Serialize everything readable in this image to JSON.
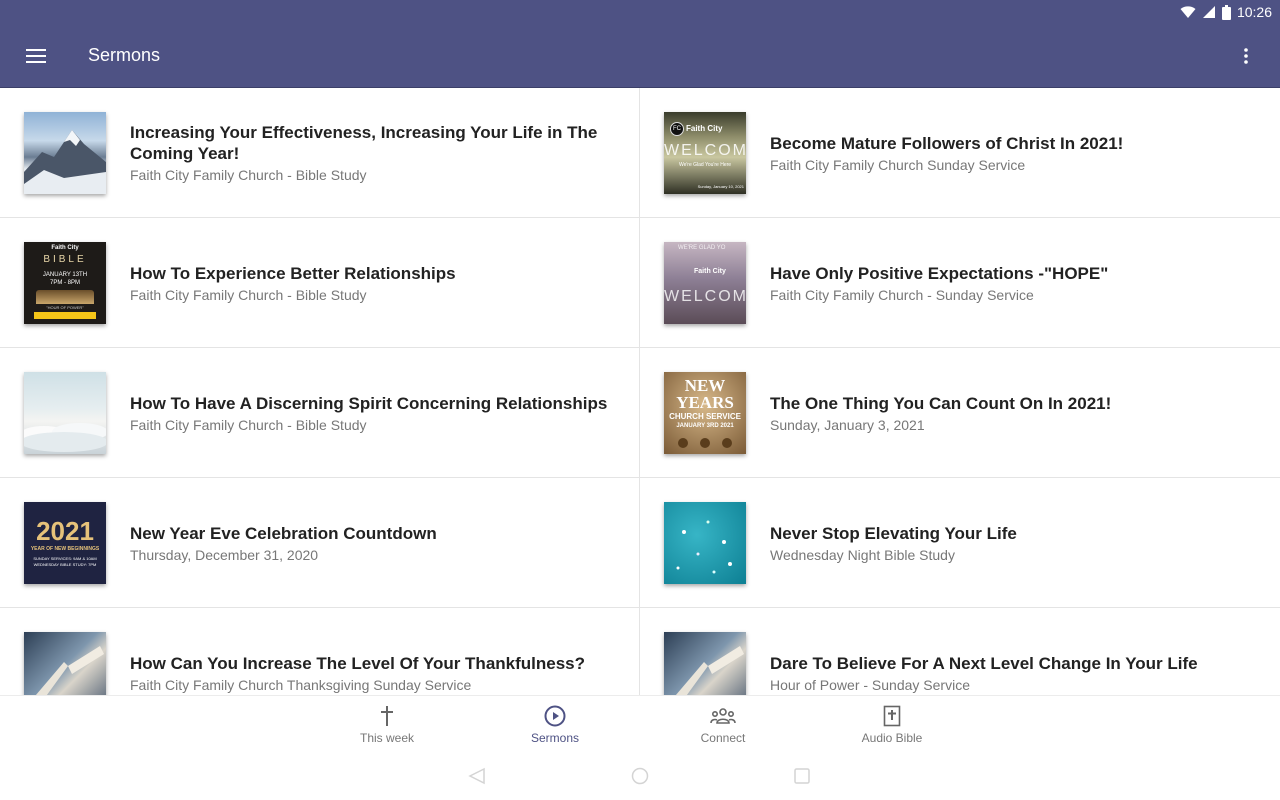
{
  "status": {
    "time": "10:26"
  },
  "appbar": {
    "title": "Sermons"
  },
  "sermons": [
    {
      "title": "Increasing Your Effectiveness, Increasing Your Life in The Coming Year!",
      "subtitle": "Faith City Family Church - Bible Study",
      "thumb": "mountain"
    },
    {
      "title": "Become Mature Followers of Christ In 2021!",
      "subtitle": "Faith City Family Church Sunday Service",
      "thumb": "welcome"
    },
    {
      "title": "How To Experience Better Relationships",
      "subtitle": "Faith City Family Church - Bible Study",
      "thumb": "bible"
    },
    {
      "title": "Have Only Positive Expectations -\"HOPE\"",
      "subtitle": "Faith City Family Church - Sunday Service",
      "thumb": "welcome2"
    },
    {
      "title": "How To Have A Discerning Spirit Concerning Relationships",
      "subtitle": "Faith City Family Church - Bible Study",
      "thumb": "clouds"
    },
    {
      "title": "The One Thing You Can Count On In 2021!",
      "subtitle": "Sunday, January 3, 2021",
      "thumb": "newyears"
    },
    {
      "title": "New Year Eve Celebration Countdown",
      "subtitle": "Thursday, December 31, 2020",
      "thumb": "2021"
    },
    {
      "title": "Never Stop Elevating Your Life",
      "subtitle": "Wednesday Night Bible Study",
      "thumb": "teal"
    },
    {
      "title": "How Can You Increase The Level Of Your Thankfulness?",
      "subtitle": "Faith City Family Church Thanksgiving Sunday Service",
      "thumb": "book"
    },
    {
      "title": "Dare To Believe For A Next Level Change In Your Life",
      "subtitle": "Hour of Power - Sunday Service",
      "thumb": "book"
    }
  ],
  "thumb_text": {
    "welcome": {
      "logo": "Faith City",
      "word": "WELCOME",
      "line": "We're Glad You're Here",
      "date": "Sunday, January 10, 2021"
    },
    "bible": {
      "logo": "Faith City",
      "word": "BIBLE",
      "date": "JANUARY 13TH",
      "time": "7PM - 8PM",
      "tag": "\"HOUR OF POWER\""
    },
    "welcome2": {
      "logo": "Faith City",
      "word": "WELCOME",
      "top": "WE'RE GLAD YO"
    },
    "newyears": {
      "line1": "NEW",
      "line2": "YEARS",
      "line3": "CHURCH SERVICE",
      "date": "JANUARY 3RD 2021"
    },
    "y2021": {
      "year": "2021",
      "line1": "YEAR OF NEW BEGINNINGS",
      "line2": "SUNDAY SERVICES: 9AM & 10AM",
      "line3": "WEDNESDAY BIBLE STUDY: 7PM"
    }
  },
  "bottom_nav": [
    {
      "label": "This week",
      "icon": "cross-icon",
      "active": false
    },
    {
      "label": "Sermons",
      "icon": "play-circle-icon",
      "active": true
    },
    {
      "label": "Connect",
      "icon": "people-icon",
      "active": false
    },
    {
      "label": "Audio Bible",
      "icon": "bible-icon",
      "active": false
    }
  ],
  "colors": {
    "primary": "#4e5284",
    "active_nav": "#4e5284"
  }
}
